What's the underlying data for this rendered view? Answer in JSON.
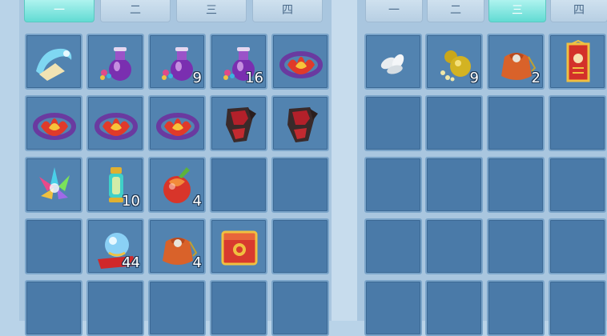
{
  "left_tabs": [
    "一",
    "二",
    "三",
    "四"
  ],
  "left_active_tab": 0,
  "right_tabs": [
    "一",
    "二",
    "三",
    "四"
  ],
  "right_active_tab": 2,
  "left_slots": [
    {
      "icon": "scroll-icon",
      "qty": ""
    },
    {
      "icon": "potion-bottle-icon",
      "qty": ""
    },
    {
      "icon": "potion-bottle-icon",
      "qty": "9"
    },
    {
      "icon": "potion-bottle-icon",
      "qty": "16"
    },
    {
      "icon": "flame-crown-icon",
      "qty": ""
    },
    {
      "icon": "flame-crown-icon",
      "qty": ""
    },
    {
      "icon": "flame-crown-icon",
      "qty": ""
    },
    {
      "icon": "flame-crown-icon",
      "qty": ""
    },
    {
      "icon": "armor-gauntlet-icon",
      "qty": ""
    },
    {
      "icon": "armor-gauntlet-icon",
      "qty": ""
    },
    {
      "icon": "crystal-cluster-icon",
      "qty": ""
    },
    {
      "icon": "lantern-icon",
      "qty": "10"
    },
    {
      "icon": "magic-fruit-icon",
      "qty": "4"
    },
    {
      "icon": "",
      "qty": ""
    },
    {
      "icon": "",
      "qty": ""
    },
    {
      "icon": "",
      "qty": ""
    },
    {
      "icon": "crystal-orb-icon",
      "qty": "44"
    },
    {
      "icon": "lucky-bag-icon",
      "qty": "4"
    },
    {
      "icon": "gift-chest-icon",
      "qty": ""
    },
    {
      "icon": "",
      "qty": ""
    },
    {
      "icon": "",
      "qty": ""
    },
    {
      "icon": "",
      "qty": ""
    },
    {
      "icon": "",
      "qty": ""
    },
    {
      "icon": "",
      "qty": ""
    },
    {
      "icon": "",
      "qty": ""
    }
  ],
  "right_slots": [
    {
      "icon": "seeds-icon",
      "qty": ""
    },
    {
      "icon": "gourd-icon",
      "qty": "9"
    },
    {
      "icon": "lucky-bag-icon",
      "qty": "2"
    },
    {
      "icon": "red-talisman-icon",
      "qty": ""
    },
    {
      "icon": "",
      "qty": ""
    },
    {
      "icon": "",
      "qty": ""
    },
    {
      "icon": "",
      "qty": ""
    },
    {
      "icon": "",
      "qty": ""
    },
    {
      "icon": "",
      "qty": ""
    },
    {
      "icon": "",
      "qty": ""
    },
    {
      "icon": "",
      "qty": ""
    },
    {
      "icon": "",
      "qty": ""
    },
    {
      "icon": "",
      "qty": ""
    },
    {
      "icon": "",
      "qty": ""
    },
    {
      "icon": "",
      "qty": ""
    },
    {
      "icon": "",
      "qty": ""
    },
    {
      "icon": "",
      "qty": ""
    },
    {
      "icon": "",
      "qty": ""
    },
    {
      "icon": "",
      "qty": ""
    },
    {
      "icon": "",
      "qty": ""
    }
  ]
}
